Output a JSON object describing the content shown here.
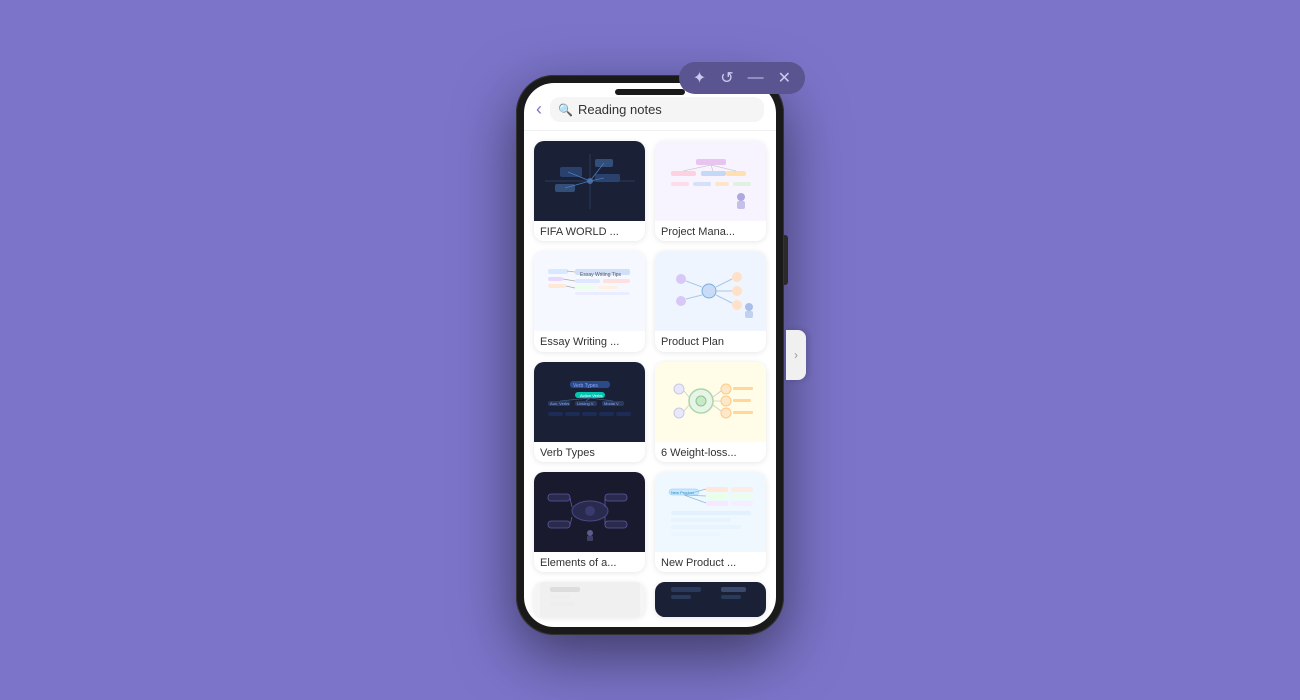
{
  "window": {
    "icons": [
      "star",
      "refresh",
      "minimize",
      "close"
    ]
  },
  "search": {
    "placeholder": "Reading notes",
    "value": "Reading notes"
  },
  "back_button": "‹",
  "scroll_arrow": "›",
  "cards": [
    {
      "id": "card-fifa",
      "label": "FIFA WORLD ...",
      "thumb_type": "fifa"
    },
    {
      "id": "card-project-mana",
      "label": "Project Mana...",
      "thumb_type": "project"
    },
    {
      "id": "card-essay",
      "label": "Essay Writing ...",
      "thumb_type": "essay"
    },
    {
      "id": "card-product-plan",
      "label": "Product Plan",
      "thumb_type": "product_plan"
    },
    {
      "id": "card-verb",
      "label": "Verb Types",
      "thumb_type": "verb"
    },
    {
      "id": "card-weight",
      "label": "6 Weight-loss...",
      "thumb_type": "weight"
    },
    {
      "id": "card-elements",
      "label": "Elements of a...",
      "thumb_type": "elements"
    },
    {
      "id": "card-new-product",
      "label": "New Product ...",
      "thumb_type": "new_product"
    },
    {
      "id": "card-partial-left",
      "label": "",
      "thumb_type": "partial"
    },
    {
      "id": "card-partial-right",
      "label": "",
      "thumb_type": "partial_dark"
    }
  ]
}
